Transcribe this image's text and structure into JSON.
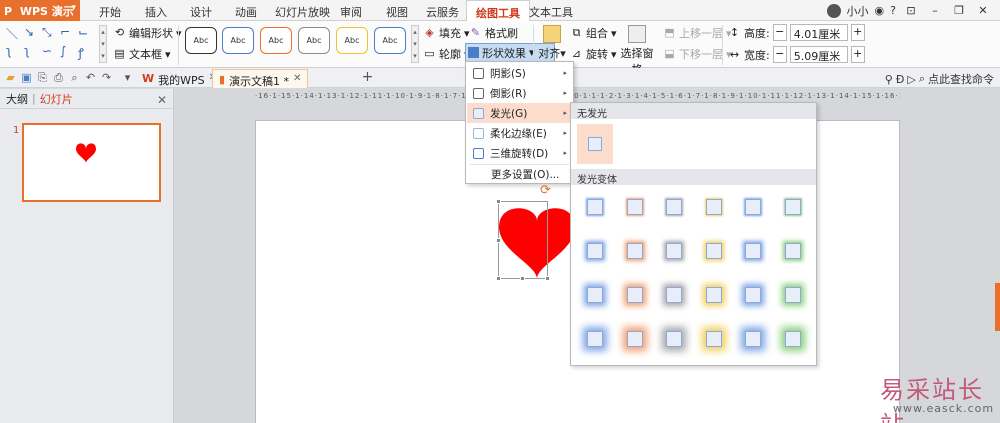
{
  "app": {
    "name": "WPS 演示",
    "logo": "P"
  },
  "tabs": [
    "开始",
    "插入",
    "设计",
    "动画",
    "幻灯片放映",
    "审阅",
    "视图",
    "云服务",
    "绘图工具",
    "文本工具"
  ],
  "active_tab": "绘图工具",
  "user": {
    "name": "小小"
  },
  "ribbon": {
    "edit_shape": "编辑形状",
    "textbox": "文本框",
    "style_label": "Abc",
    "style_colors": [
      "#333333",
      "#4a7ec5",
      "#e8702c",
      "#8a8a8a",
      "#f2c230",
      "#4a7ec5"
    ],
    "fill": "填充",
    "format_painter": "格式刷",
    "outline": "轮廓",
    "shape_effects": "形状效果",
    "align": "对齐",
    "group": "组合",
    "rotate": "旋转",
    "selection_pane": "选择窗格",
    "bring_forward": "上移一层",
    "send_backward": "下移一层",
    "height_label": "高度:",
    "height_value": "4.01厘米",
    "width_label": "宽度:",
    "width_value": "5.09厘米"
  },
  "doc_tabs": [
    {
      "label": "我的WPS"
    },
    {
      "label": "演示文稿1 *"
    }
  ],
  "search_cmd": "点此查找命令",
  "left_panel": {
    "outline": "大纲",
    "slides": "幻灯片",
    "thumb_number": "1"
  },
  "ruler_text": "·16·1·15·1·14·1·13·1·12·1·11·1·10·1·9·1·8·1·7·1·6·1·5·1·4·1·3·1·2·1·1·1·0·1·1·1·2·1·3·1·4·1·5·1·6·1·7·1·8·1·9·1·10·1·11·1·12·1·13·1·14·1·15·1·16·1·",
  "effects_menu": [
    {
      "label": "阴影(S)",
      "submenu": true
    },
    {
      "label": "倒影(R)",
      "submenu": true
    },
    {
      "label": "发光(G)",
      "submenu": true
    },
    {
      "label": "柔化边缘(E)",
      "submenu": true
    },
    {
      "label": "三维旋转(D)",
      "submenu": true
    },
    {
      "label": "更多设置(O)...",
      "submenu": false
    }
  ],
  "glow_panel": {
    "no_glow": "无发光",
    "variants": "发光变体",
    "variant_colors": [
      "#7fa6e6",
      "#f0a070",
      "#a8a8a8",
      "#f2d060",
      "#7fa6e6",
      "#8ccf7a"
    ]
  },
  "colors": {
    "accent": "#e8702c",
    "heart": "#ff0000",
    "highlight": "#fcdccc"
  },
  "watermark": {
    "text": "易采站长站",
    "url": "www.easck.com"
  }
}
